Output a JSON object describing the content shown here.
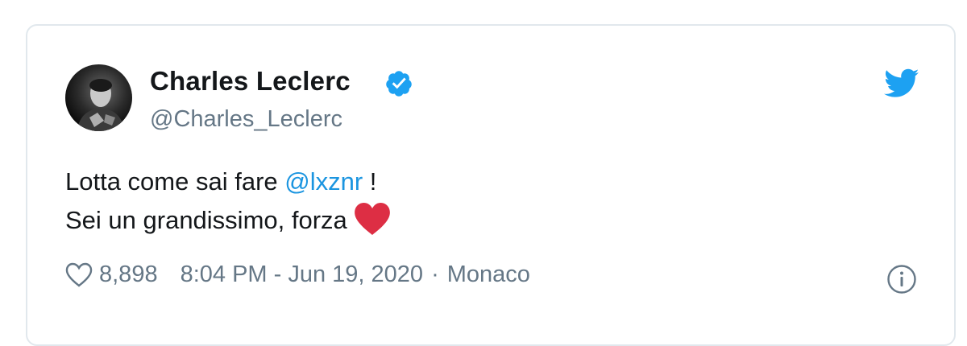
{
  "author": {
    "name": "Charles Leclerc",
    "handle": "@Charles_Leclerc",
    "verified": true
  },
  "tweet": {
    "line1_text": "Lotta come sai fare ",
    "mention": "@lxznr",
    "line1_suffix": " !",
    "line2_text": "Sei un grandissimo, forza"
  },
  "footer": {
    "likes": "8,898",
    "timestamp": "8:04 PM - Jun 19, 2020",
    "separator": "·",
    "location": "Monaco"
  },
  "icons": {
    "like": "heart-outline-icon",
    "verified": "verified-badge-icon",
    "brand": "twitter-bird-icon",
    "info": "info-icon",
    "emoji": "red-heart-emoji"
  },
  "colors": {
    "text": "#14171a",
    "secondary": "#657786",
    "link": "#1b95e0",
    "twitter_blue": "#1da1f2",
    "heart_red": "#dd2e44"
  }
}
